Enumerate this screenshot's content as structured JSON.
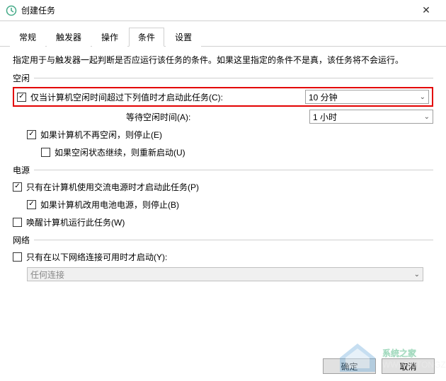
{
  "window": {
    "title": "创建任务"
  },
  "tabs": {
    "t0": "常规",
    "t1": "触发器",
    "t2": "操作",
    "t3": "条件",
    "t4": "设置"
  },
  "desc": "指定用于与触发器一起判断是否应运行该任务的条件。如果这里指定的条件不是真，该任务将不会运行。",
  "sections": {
    "idle": "空闲",
    "power": "电源",
    "network": "网络"
  },
  "idle": {
    "chk1": "仅当计算机空闲时间超过下列值时才启动此任务(C):",
    "combo1": "10 分钟",
    "waitLabel": "等待空闲时间(A):",
    "combo2": "1 小时",
    "chk2": "如果计算机不再空闲，则停止(E)",
    "chk3": "如果空闲状态继续，则重新启动(U)"
  },
  "power": {
    "chk1": "只有在计算机使用交流电源时才启动此任务(P)",
    "chk2": "如果计算机改用电池电源，则停止(B)",
    "chk3": "唤醒计算机运行此任务(W)"
  },
  "network": {
    "chk1": "只有在以下网络连接可用时才启动(Y):",
    "combo": "任何连接"
  },
  "buttons": {
    "ok": "确定",
    "cancel": "取消"
  },
  "watermark": {
    "text": "系统之家",
    "url": "WWW.XITONGZHIJIA.NET"
  }
}
